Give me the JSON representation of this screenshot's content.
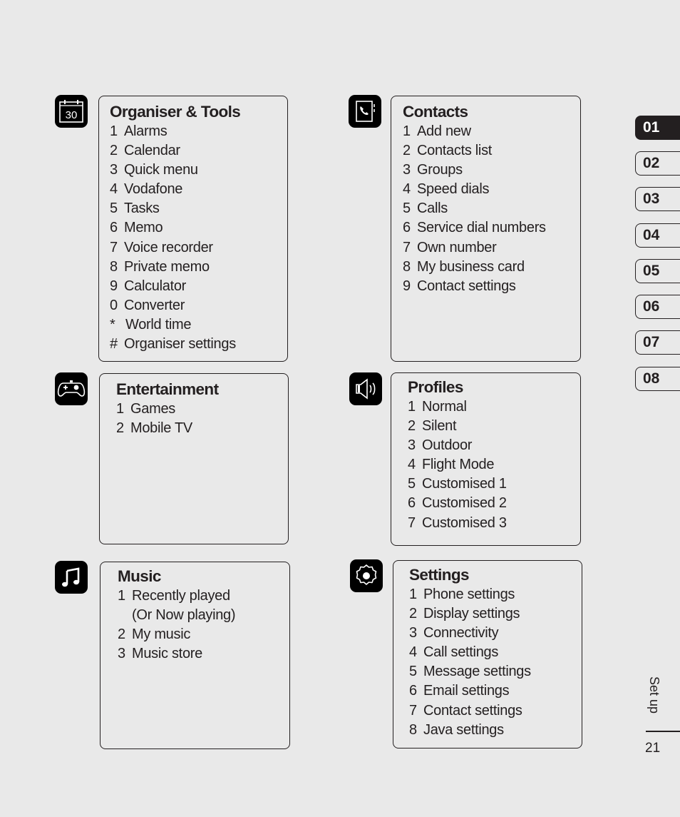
{
  "sections": [
    {
      "id": "organiser",
      "icon": "calendar-icon",
      "icon_text": "30",
      "title": "Organiser & Tools",
      "items": [
        {
          "num": "1",
          "label": "Alarms"
        },
        {
          "num": "2",
          "label": "Calendar"
        },
        {
          "num": "3",
          "label": "Quick menu"
        },
        {
          "num": "4",
          "label": "Vodafone"
        },
        {
          "num": "5",
          "label": "Tasks"
        },
        {
          "num": "6",
          "label": "Memo"
        },
        {
          "num": "7",
          "label": "Voice recorder"
        },
        {
          "num": "8",
          "label": "Private memo"
        },
        {
          "num": "9",
          "label": "Calculator"
        },
        {
          "num": "0",
          "label": "Converter"
        },
        {
          "num": "*",
          "label": "World time"
        },
        {
          "num": "#",
          "label": "Organiser settings"
        }
      ]
    },
    {
      "id": "contacts",
      "icon": "phonebook-icon",
      "title": "Contacts",
      "items": [
        {
          "num": "1",
          "label": "Add new"
        },
        {
          "num": "2",
          "label": "Contacts list"
        },
        {
          "num": "3",
          "label": "Groups"
        },
        {
          "num": "4",
          "label": "Speed dials"
        },
        {
          "num": "5",
          "label": "Calls"
        },
        {
          "num": "6",
          "label": "Service dial numbers"
        },
        {
          "num": "7",
          "label": "Own number"
        },
        {
          "num": "8",
          "label": "My business card"
        },
        {
          "num": "9",
          "label": "Contact settings"
        }
      ]
    },
    {
      "id": "entertainment",
      "icon": "gamepad-icon",
      "title": "Entertainment",
      "items": [
        {
          "num": "1",
          "label": "Games"
        },
        {
          "num": "2",
          "label": "Mobile TV"
        }
      ]
    },
    {
      "id": "profiles",
      "icon": "speaker-icon",
      "title": "Profiles",
      "items": [
        {
          "num": "1",
          "label": "Normal"
        },
        {
          "num": "2",
          "label": "Silent"
        },
        {
          "num": "3",
          "label": "Outdoor"
        },
        {
          "num": "4",
          "label": "Flight Mode"
        },
        {
          "num": "5",
          "label": "Customised 1"
        },
        {
          "num": "6",
          "label": "Customised 2"
        },
        {
          "num": "7",
          "label": "Customised 3"
        }
      ]
    },
    {
      "id": "music",
      "icon": "music-note-icon",
      "title": "Music",
      "items": [
        {
          "num": "1",
          "label": "Recently played"
        },
        {
          "num": "",
          "label": "(Or Now playing)"
        },
        {
          "num": "2",
          "label": "My music"
        },
        {
          "num": "3",
          "label": "Music store"
        }
      ]
    },
    {
      "id": "settings",
      "icon": "gear-icon",
      "title": "Settings",
      "items": [
        {
          "num": "1",
          "label": "Phone settings"
        },
        {
          "num": "2",
          "label": "Display settings"
        },
        {
          "num": "3",
          "label": "Connectivity"
        },
        {
          "num": "4",
          "label": "Call settings"
        },
        {
          "num": "5",
          "label": "Message settings"
        },
        {
          "num": "6",
          "label": "Email settings"
        },
        {
          "num": "7",
          "label": "Contact settings"
        },
        {
          "num": "8",
          "label": "Java settings"
        }
      ]
    }
  ],
  "chapter_tabs": [
    {
      "label": "01",
      "active": true
    },
    {
      "label": "02",
      "active": false
    },
    {
      "label": "03",
      "active": false
    },
    {
      "label": "04",
      "active": false
    },
    {
      "label": "05",
      "active": false
    },
    {
      "label": "06",
      "active": false
    },
    {
      "label": "07",
      "active": false
    },
    {
      "label": "08",
      "active": false
    }
  ],
  "footer": {
    "section_label": "Set up",
    "page_number": "21"
  }
}
